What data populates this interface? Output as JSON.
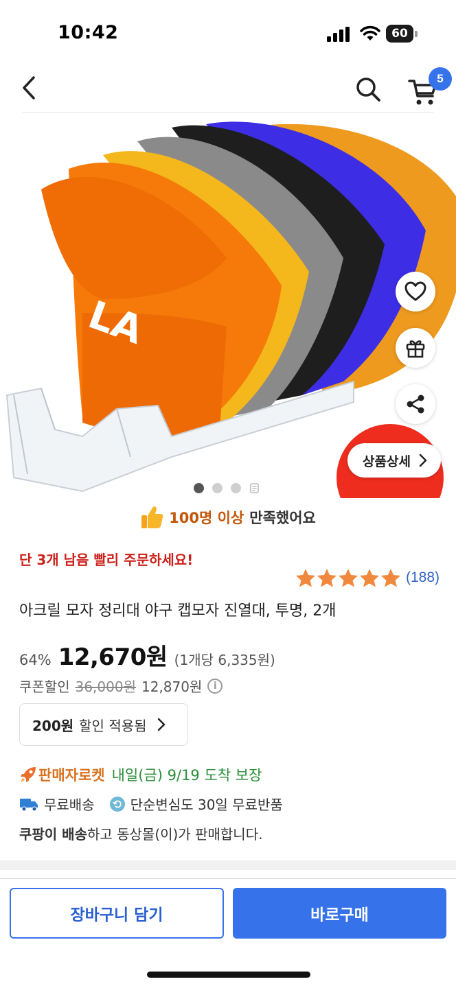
{
  "status_bar": {
    "time": "10:42",
    "battery": "60"
  },
  "nav": {
    "cart_badge": "5"
  },
  "gallery": {
    "detail_button": "상품상세",
    "page_count": 4,
    "active_page": 1
  },
  "satisfaction": {
    "emphasis": "100명 이상",
    "rest": "만족했어요"
  },
  "stock_warning": "단 3개 남음 빨리 주문하세요!",
  "rating": {
    "stars": 5,
    "count": "(188)"
  },
  "product": {
    "title": "아크릴 모자 정리대 야구 캡모자 진열대, 투명, 2개"
  },
  "price": {
    "discount_rate": "64%",
    "final": "12,670원",
    "unit": "(1개당 6,335원)",
    "coupon_label": "쿠폰할인",
    "original": "36,000원",
    "before_coupon": "12,870원"
  },
  "coupon_button": {
    "amount": "200원",
    "text": "할인 적용됨"
  },
  "delivery": {
    "seller_type": "판매자로켓",
    "arrival": "내일(금) 9/19 도착 보장"
  },
  "benefits": {
    "free_shipping": "무료배송",
    "returns": "단순변심도 30일 무료반품"
  },
  "seller": {
    "bold": "쿠팡이 배송",
    "rest": "하고 동상몰(이)가 판매합니다."
  },
  "buttons": {
    "add_to_cart": "장바구니 담기",
    "buy_now": "바로구매"
  },
  "colors": {
    "accent": "#3673ea",
    "warning": "#cc1f1a",
    "arrival": "#2a8d38",
    "rocket": "#d9711e",
    "star": "#f0883e"
  }
}
